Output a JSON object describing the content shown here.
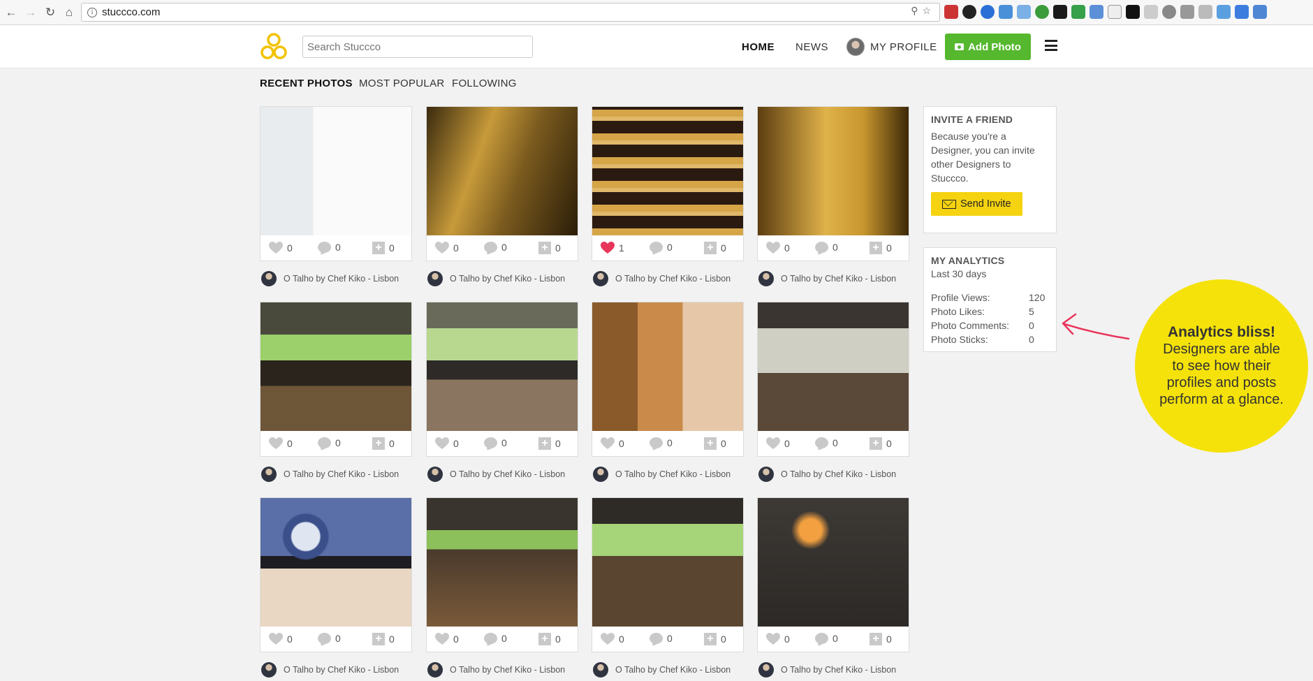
{
  "browser": {
    "url": "stuccco.com"
  },
  "header": {
    "search_placeholder": "Search Stuccco",
    "nav": {
      "home": "HOME",
      "news": "NEWS",
      "profile": "MY PROFILE"
    },
    "add_photo": "Add Photo"
  },
  "tabs": [
    "RECENT PHOTOS",
    "MOST POPULAR",
    "FOLLOWING"
  ],
  "photos": [
    {
      "likes": "0",
      "comments": "0",
      "sticks": "0",
      "liked": false,
      "author": "O Talho by Chef Kiko - Lisbon"
    },
    {
      "likes": "0",
      "comments": "0",
      "sticks": "0",
      "liked": false,
      "author": "O Talho by Chef Kiko - Lisbon"
    },
    {
      "likes": "1",
      "comments": "0",
      "sticks": "0",
      "liked": true,
      "author": "O Talho by Chef Kiko - Lisbon"
    },
    {
      "likes": "0",
      "comments": "0",
      "sticks": "0",
      "liked": false,
      "author": "O Talho by Chef Kiko - Lisbon"
    },
    {
      "likes": "0",
      "comments": "0",
      "sticks": "0",
      "liked": false,
      "author": "O Talho by Chef Kiko - Lisbon"
    },
    {
      "likes": "0",
      "comments": "0",
      "sticks": "0",
      "liked": false,
      "author": "O Talho by Chef Kiko - Lisbon"
    },
    {
      "likes": "0",
      "comments": "0",
      "sticks": "0",
      "liked": false,
      "author": "O Talho by Chef Kiko - Lisbon"
    },
    {
      "likes": "0",
      "comments": "0",
      "sticks": "0",
      "liked": false,
      "author": "O Talho by Chef Kiko - Lisbon"
    },
    {
      "likes": "0",
      "comments": "0",
      "sticks": "0",
      "liked": false,
      "author": "O Talho by Chef Kiko - Lisbon"
    },
    {
      "likes": "0",
      "comments": "0",
      "sticks": "0",
      "liked": false,
      "author": "O Talho by Chef Kiko - Lisbon"
    },
    {
      "likes": "0",
      "comments": "0",
      "sticks": "0",
      "liked": false,
      "author": "O Talho by Chef Kiko - Lisbon"
    },
    {
      "likes": "0",
      "comments": "0",
      "sticks": "0",
      "liked": false,
      "author": "O Talho by Chef Kiko - Lisbon"
    }
  ],
  "invite": {
    "title": "INVITE A FRIEND",
    "body": "Because you're a Designer, you can invite other Designers to Stuccco.",
    "button": "Send Invite"
  },
  "analytics": {
    "title": "MY ANALYTICS",
    "subtitle": "Last 30 days",
    "stats": [
      {
        "label": "Profile Views:",
        "value": "120"
      },
      {
        "label": "Photo Likes:",
        "value": "5"
      },
      {
        "label": "Photo Comments:",
        "value": "0"
      },
      {
        "label": "Photo Sticks:",
        "value": "0"
      }
    ]
  },
  "callout": {
    "title": "Analytics bliss!",
    "body": "Designers are able to see how their profiles and posts perform at a glance."
  },
  "colors": {
    "add_button": "#55b82e",
    "accent_yellow": "#f5d311",
    "callout_yellow": "#f5e20a",
    "liked_heart": "#e8355a",
    "arrow": "#e8355a"
  }
}
